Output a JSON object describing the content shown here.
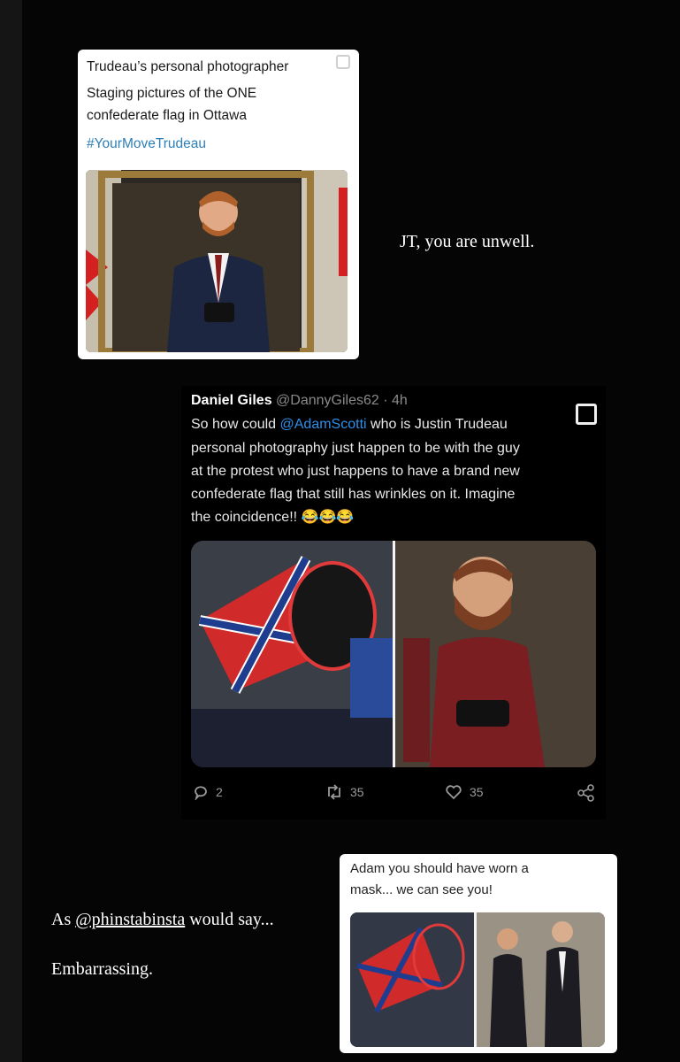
{
  "card1": {
    "title": "Trudeau’s personal photographer",
    "line2": "Staging pictures of the ONE",
    "line3": "confederate flag in Ottawa",
    "hashtag": "#YourMoveTrudeau"
  },
  "story": {
    "caption1": "JT, you are unwell.",
    "caption2_prefix": "As ",
    "caption2_handle": "@phinstabinsta",
    "caption2_suffix": " would say...",
    "caption3": "Embarrassing."
  },
  "tweet": {
    "author": "Daniel Giles",
    "handle": "@DannyGiles62",
    "time": "· 4h",
    "line1_a": "So how could ",
    "mention": "@AdamScotti",
    "line1_b": " who is Justin Trudeau",
    "line2": "personal photography just happen to be with the guy",
    "line3": "at the protest who just happens to have a brand new",
    "line4": "confederate flag that still has wrinkles on it. Imagine",
    "line5": "the coincidence!! 😂😂😂",
    "replies": "2",
    "retweets": "35",
    "likes": "35"
  },
  "card3": {
    "line1": "Adam you should have worn a",
    "line2": "mask... we can see you!"
  },
  "icons": {
    "reply": "reply-icon",
    "retweet": "retweet-icon",
    "like": "heart-icon",
    "share": "share-icon"
  }
}
